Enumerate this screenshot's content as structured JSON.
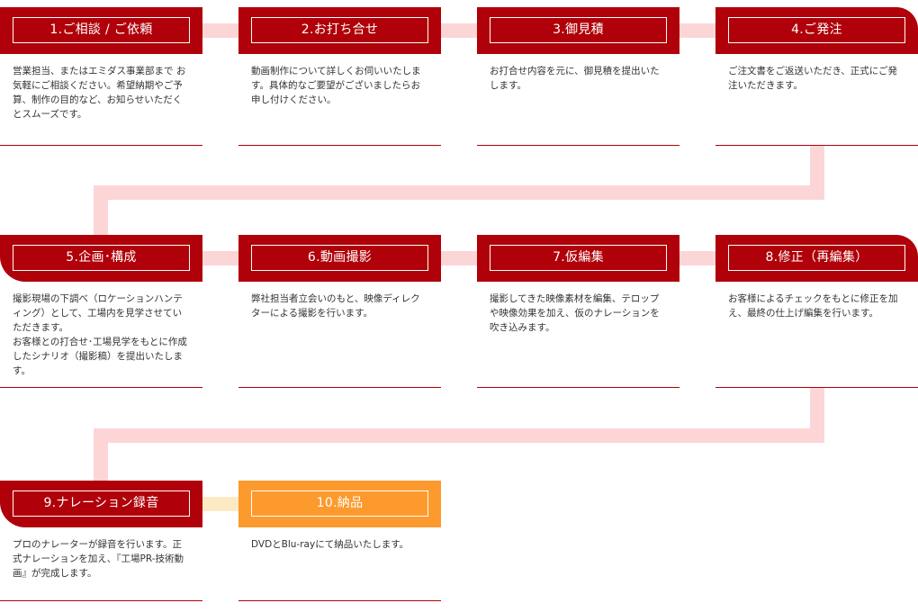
{
  "colors": {
    "header_red": "#b00009",
    "header_orange": "#fd9a2d",
    "connector_pink": "#fcd5d7",
    "connector_cream": "#fde9c4",
    "text": "#333333"
  },
  "steps": [
    {
      "title": "1.ご相談 / ご依頼",
      "text": "営業担当、またはエミダス事業部まで お気軽にご相談ください。希望納期やご予算、制作の目的など、お知らせいただくとスムーズです。"
    },
    {
      "title": "2.お打ち合せ",
      "text": "動画制作について詳しくお伺いいたします。具体的なご要望がございましたらお申し付けください。"
    },
    {
      "title": "3.御見積",
      "text": "お打合せ内容を元に、御見積を提出いたします。"
    },
    {
      "title": "4.ご発注",
      "text": "ご注文書をご返送いただき、正式にご発注いただきます。"
    },
    {
      "title": "5.企画･構成",
      "text": "撮影現場の下調べ（ロケーションハンティング）として、工場内を見学させていただきます。\nお客様との打合せ･工場見学をもとに作成したシナリオ（撮影稿）を提出いたします。"
    },
    {
      "title": "6.動画撮影",
      "text": "弊社担当者立会いのもと、映像ディレクターによる撮影を行います。"
    },
    {
      "title": "7.仮編集",
      "text": "撮影してきた映像素材を編集、テロップや映像効果を加え、仮のナレーションを吹き込みます。"
    },
    {
      "title": "8.修正（再編集）",
      "text": "お客様によるチェックをもとに修正を加え、最終の仕上げ編集を行います。"
    },
    {
      "title": "9.ナレーション録音",
      "text": "プロのナレーターが録音を行います。正式ナレーションを加え、『工場PR-技術動画』が完成します。"
    },
    {
      "title": "10.納品",
      "text": "DVDとBlu-rayにて納品いたします。"
    }
  ]
}
